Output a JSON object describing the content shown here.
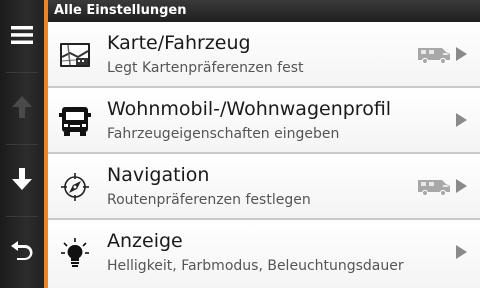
{
  "header": {
    "title": "Alle Einstellungen"
  },
  "sidebar": {
    "menu_icon": "hamburger-menu-icon",
    "up_icon": "arrow-up-icon",
    "down_icon": "arrow-down-icon",
    "back_icon": "back-icon"
  },
  "items": [
    {
      "title": "Karte/Fahrzeug",
      "subtitle": "Legt Kartenpräferenzen fest",
      "icon": "map-icon",
      "badge": "motorhome-icon"
    },
    {
      "title": "Wohnmobil-/Wohnwagenprofil",
      "subtitle": "Fahrzeugeigenschaften eingeben",
      "icon": "truck-icon"
    },
    {
      "title": "Navigation",
      "subtitle": "Routenpräferenzen festlegen",
      "icon": "compass-icon",
      "badge": "motorhome-icon"
    },
    {
      "title": "Anzeige",
      "subtitle": "Helligkeit, Farbmodus, Beleuchtungsdauer",
      "icon": "lightbulb-icon"
    }
  ],
  "colors": {
    "accent": "#e8862a",
    "title_bar": "#2a2a2a",
    "sidebar": "#252525"
  }
}
